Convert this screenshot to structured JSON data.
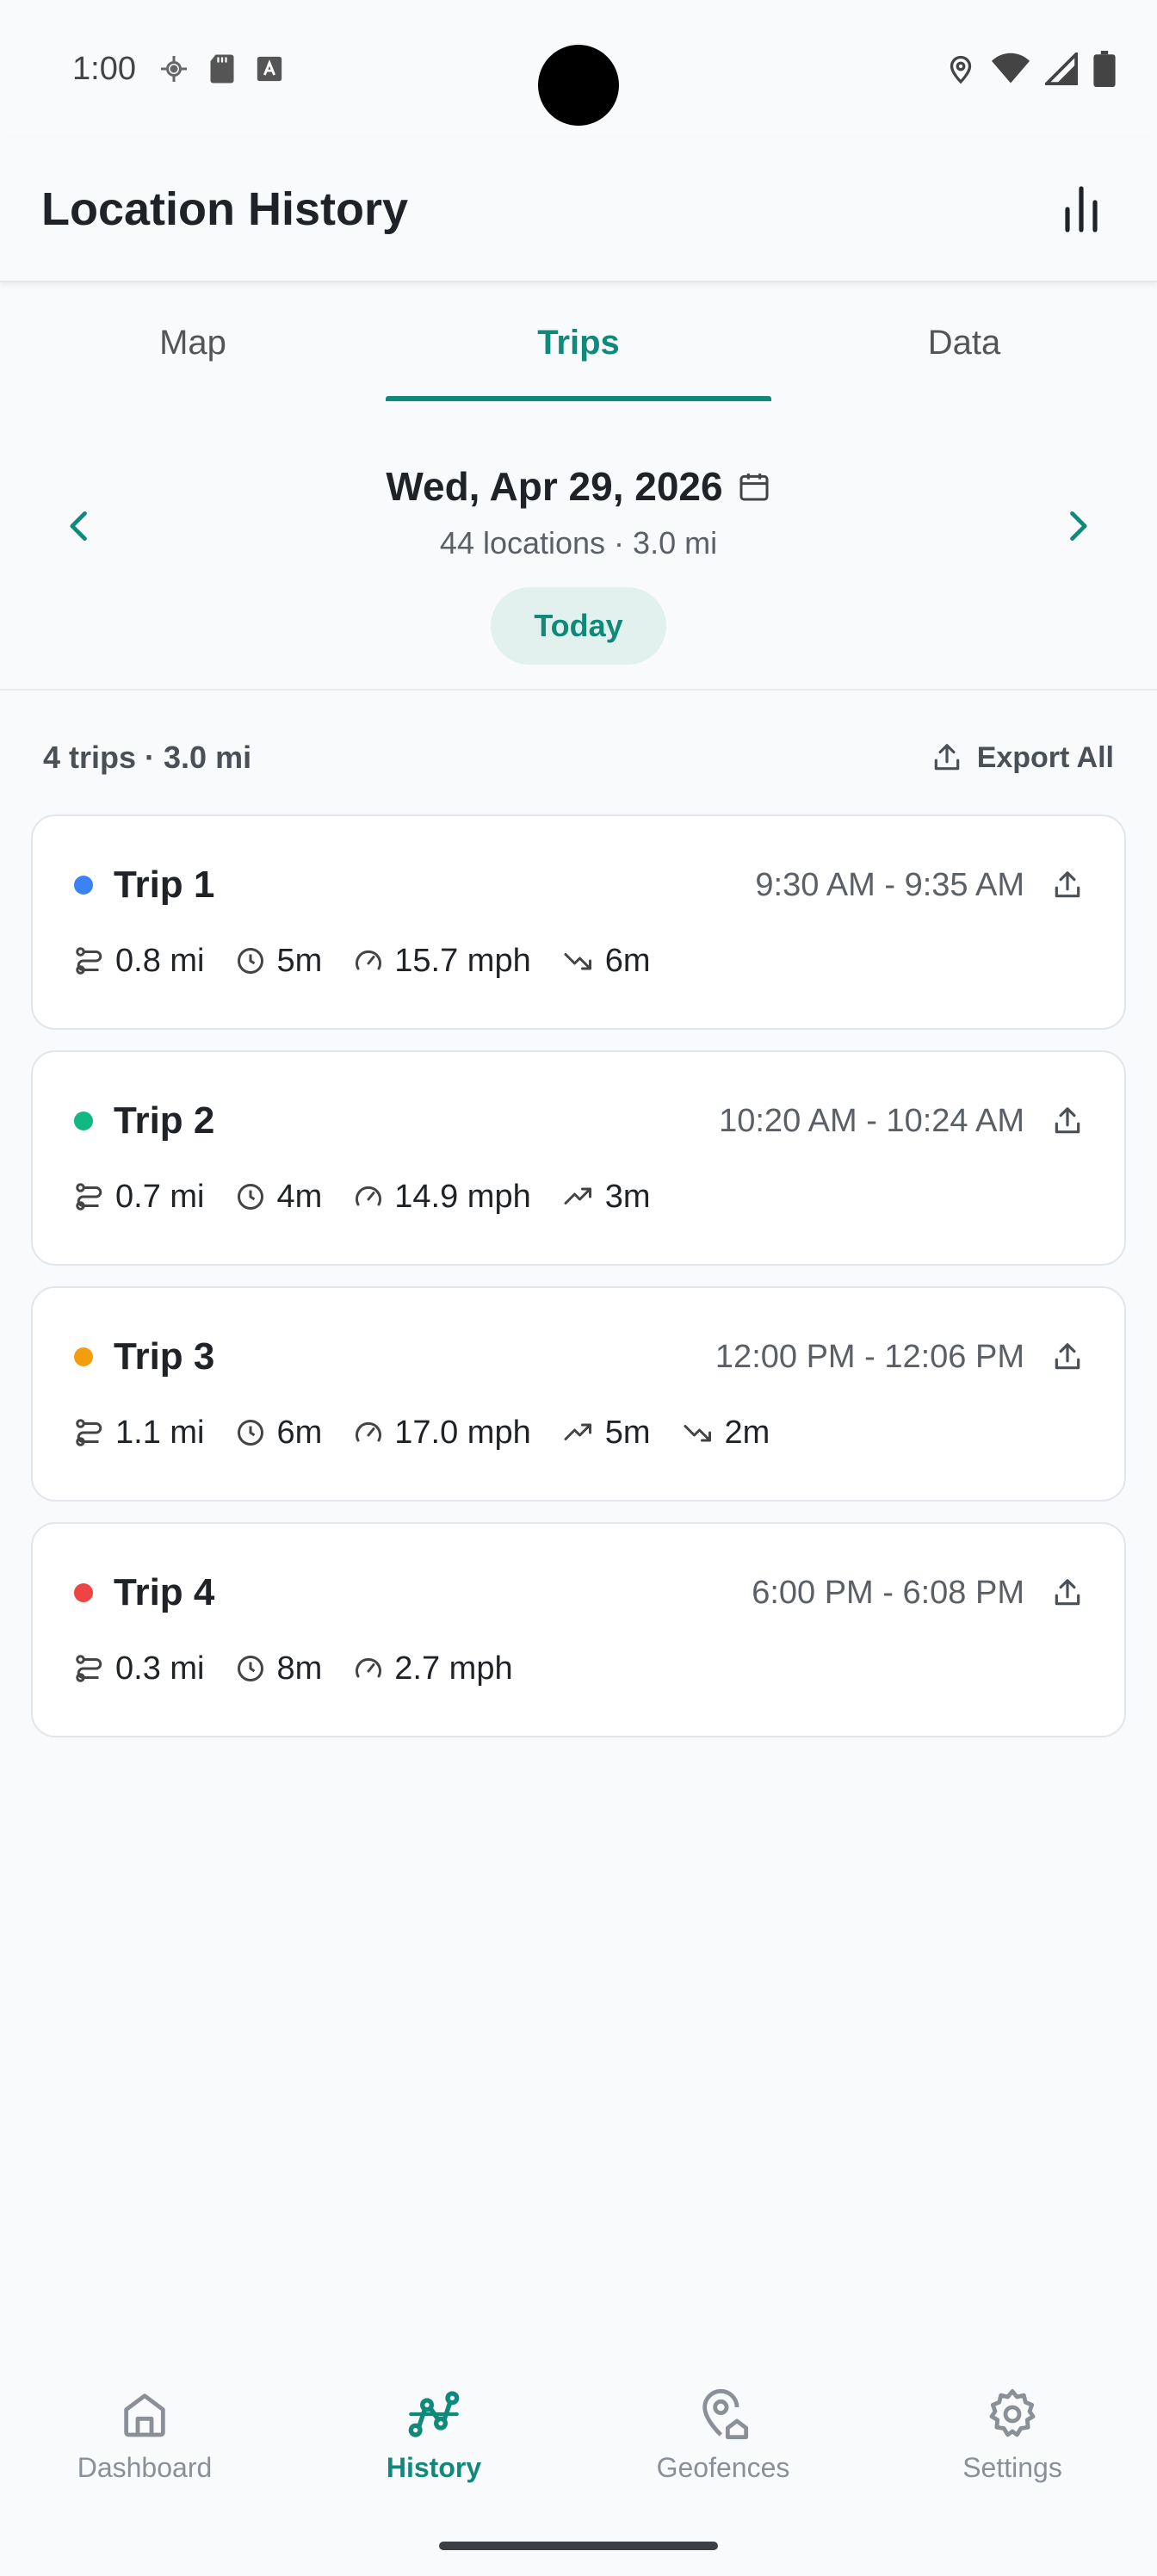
{
  "status_bar": {
    "time": "1:00"
  },
  "app_bar": {
    "title": "Location History"
  },
  "tabs": [
    {
      "label": "Map",
      "active": false
    },
    {
      "label": "Trips",
      "active": true
    },
    {
      "label": "Data",
      "active": false
    }
  ],
  "date_nav": {
    "date": "Wed, Apr 29, 2026",
    "summary": "44 locations · 3.0 mi",
    "today_label": "Today"
  },
  "summary": {
    "text": "4 trips · 3.0 mi",
    "export_label": "Export All"
  },
  "trips": [
    {
      "name": "Trip 1",
      "color": "#3b82f6",
      "time": "9:30 AM - 9:35 AM",
      "distance": "0.8 mi",
      "duration": "5m",
      "speed": "15.7 mph",
      "descent": "6m"
    },
    {
      "name": "Trip 2",
      "color": "#10b981",
      "time": "10:20 AM - 10:24 AM",
      "distance": "0.7 mi",
      "duration": "4m",
      "speed": "14.9 mph",
      "ascent": "3m"
    },
    {
      "name": "Trip 3",
      "color": "#f59e0b",
      "time": "12:00 PM - 12:06 PM",
      "distance": "1.1 mi",
      "duration": "6m",
      "speed": "17.0 mph",
      "ascent": "5m",
      "descent": "2m"
    },
    {
      "name": "Trip 4",
      "color": "#ef4444",
      "time": "6:00 PM - 6:08 PM",
      "distance": "0.3 mi",
      "duration": "8m",
      "speed": "2.7 mph"
    }
  ],
  "bottom_nav": [
    {
      "label": "Dashboard",
      "icon": "home-icon",
      "active": false
    },
    {
      "label": "History",
      "icon": "route-icon",
      "active": true
    },
    {
      "label": "Geofences",
      "icon": "geofence-pin-icon",
      "active": false
    },
    {
      "label": "Settings",
      "icon": "gear-icon",
      "active": false
    }
  ],
  "colors": {
    "accent": "#0f8a7a",
    "today_bg": "#e3f1ee"
  }
}
